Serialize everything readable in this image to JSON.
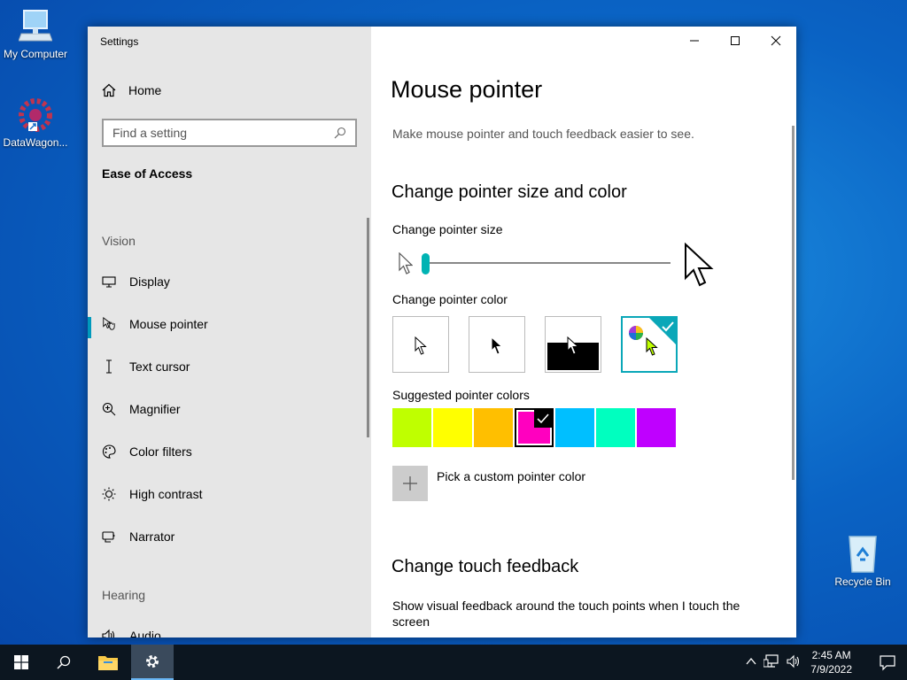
{
  "desktop": {
    "icons": [
      {
        "label": "My Computer"
      },
      {
        "label": "DataWagon..."
      },
      {
        "label": "Recycle Bin"
      }
    ]
  },
  "window": {
    "title": "Settings",
    "minimize_icon": "minimize-icon",
    "maximize_icon": "maximize-icon",
    "close_icon": "close-icon"
  },
  "sidebar": {
    "home_label": "Home",
    "search_placeholder": "Find a setting",
    "section": "Ease of Access",
    "group_vision": "Vision",
    "group_hearing": "Hearing",
    "items": [
      {
        "label": "Display",
        "icon": "monitor-icon"
      },
      {
        "label": "Mouse pointer",
        "icon": "mouse-pointer-icon",
        "selected": true
      },
      {
        "label": "Text cursor",
        "icon": "text-cursor-icon"
      },
      {
        "label": "Magnifier",
        "icon": "magnifier-icon"
      },
      {
        "label": "Color filters",
        "icon": "palette-icon"
      },
      {
        "label": "High contrast",
        "icon": "brightness-icon"
      },
      {
        "label": "Narrator",
        "icon": "narrator-icon"
      },
      {
        "label": "Audio",
        "icon": "speaker-icon"
      }
    ]
  },
  "content": {
    "title": "Mouse pointer",
    "description": "Make mouse pointer and touch feedback easier to see.",
    "size_color_heading": "Change pointer size and color",
    "pointer_size_label": "Change pointer size",
    "pointer_size_value": 1,
    "pointer_color_label": "Change pointer color",
    "pointer_color_options": [
      "white",
      "black",
      "inverted",
      "custom"
    ],
    "pointer_color_selected": "custom",
    "suggested_label": "Suggested pointer colors",
    "suggested_colors": [
      "#bfff00",
      "#ffff00",
      "#ffbf00",
      "#ff00bf",
      "#00bfff",
      "#00ffbf",
      "#bf00ff"
    ],
    "suggested_selected_index": 3,
    "custom_color_label": "Pick a custom pointer color",
    "touch_heading": "Change touch feedback",
    "touch_desc": "Show visual feedback around the touch points when I touch the screen"
  },
  "taskbar": {
    "time": "2:45 AM",
    "date": "7/9/2022",
    "accent": "#6ab7f5"
  }
}
